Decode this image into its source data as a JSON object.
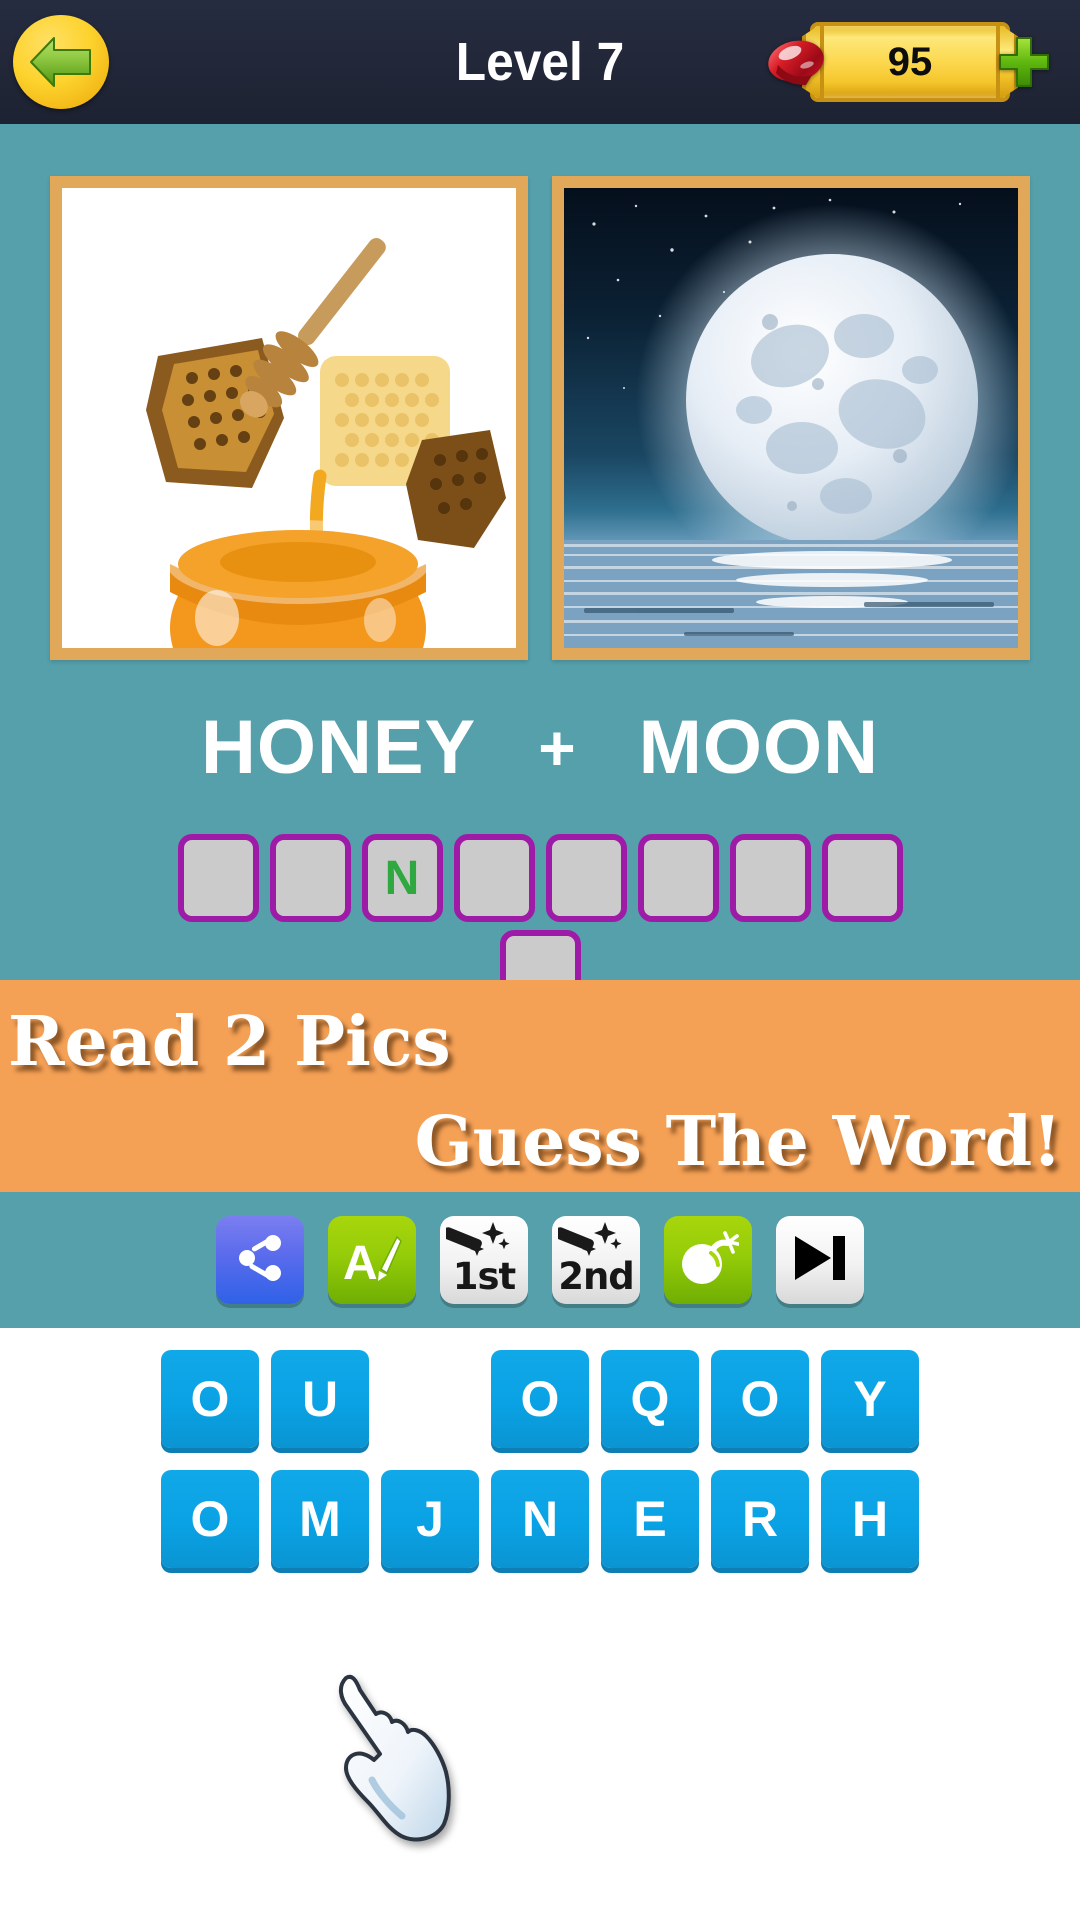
{
  "header": {
    "back_icon": "back-arrow-icon",
    "title": "Level 7",
    "gem_icon": "ruby-gem-icon",
    "coin_count": "95",
    "plus_icon": "plus-icon"
  },
  "puzzle": {
    "pictures": [
      {
        "name": "honey-picture",
        "alt": "honey jar with honeycomb and dipper"
      },
      {
        "name": "moon-picture",
        "alt": "full moon over the sea at night"
      }
    ],
    "word_left": "HONEY",
    "operator": "+",
    "word_right": "MOON",
    "answer_row_1": [
      "",
      "",
      "N",
      "",
      "",
      "",
      "",
      ""
    ],
    "answer_row_2": [
      ""
    ]
  },
  "banner": {
    "line1": "Read 2 Pics",
    "line2": "Guess The Word!"
  },
  "toolbar": {
    "buttons": [
      {
        "name": "share-button",
        "icon": "share-icon",
        "label": ""
      },
      {
        "name": "hint-letter-button",
        "icon": "letter-brush-icon",
        "label": ""
      },
      {
        "name": "reveal-first-letter-button",
        "icon": "magic-wand-icon",
        "label": "1st"
      },
      {
        "name": "reveal-second-letter-button",
        "icon": "magic-wand-icon",
        "label": "2nd"
      },
      {
        "name": "bomb-remove-letters-button",
        "icon": "bomb-icon",
        "label": ""
      },
      {
        "name": "skip-level-button",
        "icon": "skip-next-icon",
        "label": ""
      }
    ]
  },
  "keyboard": {
    "row1": [
      "O",
      "U",
      "",
      "O",
      "Q",
      "O",
      "Y"
    ],
    "row2": [
      "O",
      "M",
      "J",
      "N",
      "E",
      "R",
      "H"
    ]
  },
  "cursor": {
    "icon": "pointing-hand-cursor"
  },
  "colors": {
    "background": "#56a0ab",
    "header": "#222839",
    "banner": "#f4a055",
    "key": "#09a2e4",
    "answer_border": "#9e1ba8",
    "answer_fill": "#cbcbcb",
    "answer_letter": "#2fa83f",
    "frame": "#e2a859"
  }
}
